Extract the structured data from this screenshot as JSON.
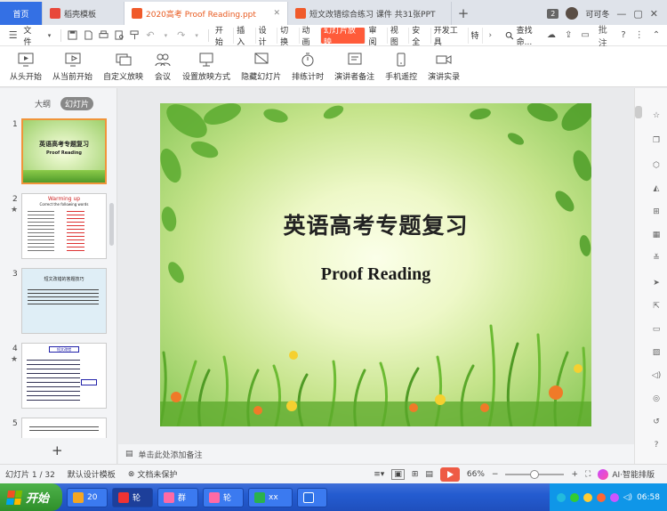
{
  "tabs": {
    "home": "首页",
    "daoke": "稻壳模板",
    "doc1": "2020高考 Proof Reading.ppt",
    "doc2": "短文改错综合练习 课件 共31张PPT",
    "badge": "2",
    "user": "可可冬"
  },
  "menu": {
    "file": "文件",
    "items": [
      "开始",
      "插入",
      "设计",
      "切换",
      "动画",
      "幻灯片放映",
      "审阅",
      "视图",
      "安全",
      "开发工具",
      "特"
    ],
    "active_index": 5,
    "search": "查找命...",
    "annotate": "批注"
  },
  "ribbon": {
    "buttons": [
      "从头开始",
      "从当前开始",
      "自定义放映",
      "会议",
      "设置放映方式",
      "隐藏幻灯片",
      "排练计时",
      "演讲者备注",
      "手机遥控",
      "演讲实录"
    ]
  },
  "left_panel": {
    "tab_outline": "大纲",
    "tab_slides": "幻灯片",
    "numbers": [
      "1",
      "2",
      "3",
      "4",
      "5"
    ],
    "t1_title": "英语高考专题复习",
    "t1_sub": "Proof Reading",
    "t2_title": "Warming up",
    "t2_sub": "Correct the following words",
    "t3_title": "短文改错的答题技巧",
    "t4_title": "短文改错"
  },
  "slide": {
    "title": "英语高考专题复习",
    "subtitle": "Proof Reading"
  },
  "notes": {
    "placeholder": "单击此处添加备注"
  },
  "status": {
    "slide_counter": "幻灯片 1 / 32",
    "design": "默认设计模板",
    "protect": "文档未保护",
    "zoom": "66%",
    "ai": "AI·智能排版"
  },
  "taskbar": {
    "start": "开始",
    "tasks": [
      "20",
      "轮",
      "群",
      "轮",
      "xx"
    ],
    "time": "06:58"
  },
  "colors": {
    "accent": "#ff5b3a",
    "home_tab": "#3470e4",
    "taskbar": "#245cd0",
    "start": "#3a9a35"
  }
}
